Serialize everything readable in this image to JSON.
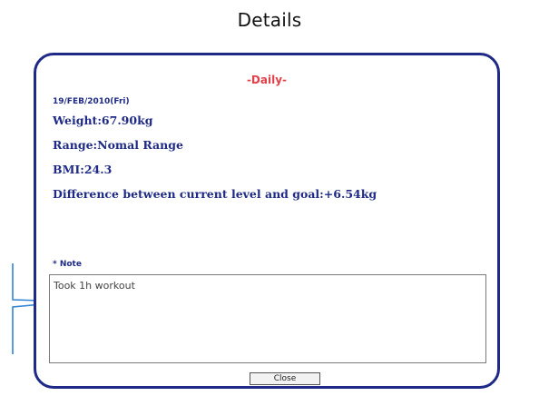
{
  "page": {
    "heading": "Details"
  },
  "dialog": {
    "title": "-Daily-",
    "date": "19/FEB/2010(Fri)",
    "weight": "Weight:67.90kg",
    "range": "Range:Nomal Range",
    "bmi": "BMI:24.3",
    "difference": "Difference between current level and goal:+6.54kg",
    "note_label": "* Note",
    "note_text": "Took 1h workout",
    "close_label": "Close"
  },
  "colors": {
    "accent_navy": "#1e2a86",
    "title_red": "#e0404a",
    "callout_blue": "#2f86d6"
  },
  "icons": {
    "callout": "callout-pointer-icon"
  }
}
